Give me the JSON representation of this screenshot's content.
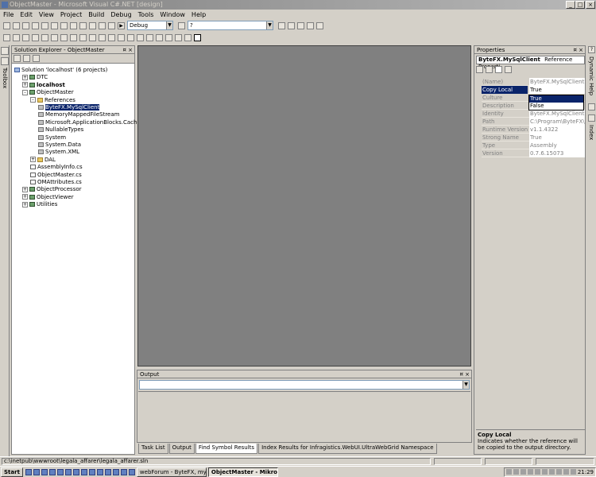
{
  "window": {
    "title": "ObjectMaster - Microsoft Visual C#.NET [design]"
  },
  "menu": [
    "File",
    "Edit",
    "View",
    "Project",
    "Build",
    "Debug",
    "Tools",
    "Window",
    "Help"
  ],
  "toolbar": {
    "config": "Debug",
    "find": "?"
  },
  "solution_explorer": {
    "title": "Solution Explorer - ObjectMaster",
    "tree": [
      {
        "label": "Solution 'localhost' (6 projects)",
        "indent": 0,
        "icon": "sol",
        "exp": ""
      },
      {
        "label": "DTC",
        "indent": 1,
        "icon": "proj",
        "exp": "+"
      },
      {
        "label": "localhost",
        "indent": 1,
        "icon": "proj",
        "exp": "+",
        "bold": true
      },
      {
        "label": "ObjectMaster",
        "indent": 1,
        "icon": "proj",
        "exp": "-"
      },
      {
        "label": "References",
        "indent": 2,
        "icon": "folder",
        "exp": "-"
      },
      {
        "label": "ByteFX.MySqlClient",
        "indent": 3,
        "icon": "ref",
        "exp": "",
        "selected": true
      },
      {
        "label": "MemoryMappedFileStream",
        "indent": 3,
        "icon": "ref",
        "exp": ""
      },
      {
        "label": "Microsoft.ApplicationBlocks.Cache",
        "indent": 3,
        "icon": "ref",
        "exp": ""
      },
      {
        "label": "NullableTypes",
        "indent": 3,
        "icon": "ref",
        "exp": ""
      },
      {
        "label": "System",
        "indent": 3,
        "icon": "ref",
        "exp": ""
      },
      {
        "label": "System.Data",
        "indent": 3,
        "icon": "ref",
        "exp": ""
      },
      {
        "label": "System.XML",
        "indent": 3,
        "icon": "ref",
        "exp": ""
      },
      {
        "label": "DAL",
        "indent": 2,
        "icon": "folder",
        "exp": "+"
      },
      {
        "label": "AssemblyInfo.cs",
        "indent": 2,
        "icon": "file",
        "exp": ""
      },
      {
        "label": "ObjectMaster.cs",
        "indent": 2,
        "icon": "file",
        "exp": ""
      },
      {
        "label": "OMAttributes.cs",
        "indent": 2,
        "icon": "file",
        "exp": ""
      },
      {
        "label": "ObjectProcessor",
        "indent": 1,
        "icon": "proj",
        "exp": "+"
      },
      {
        "label": "ObjectViewer",
        "indent": 1,
        "icon": "proj",
        "exp": "+"
      },
      {
        "label": "Utilities",
        "indent": 1,
        "icon": "proj",
        "exp": "+"
      }
    ]
  },
  "output": {
    "title": "Output"
  },
  "bottom_tabs": [
    "Task List",
    "Output",
    "Find Symbol Results",
    "Index Results for Infragistics.WebUI.UltraWebGrid Namespace"
  ],
  "properties": {
    "title": "Properties",
    "object": "ByteFX.MySqlClient",
    "object_type": "Reference Properti",
    "rows": [
      {
        "name": "(Name)",
        "value": "ByteFX.MySqlClient"
      },
      {
        "name": "Copy Local",
        "value": "True",
        "active": true
      },
      {
        "name": "Culture",
        "value": ""
      },
      {
        "name": "Description",
        "value": ""
      },
      {
        "name": "Identity",
        "value": "ByteFX.MySqlClient"
      },
      {
        "name": "Path",
        "value": "C:\\Program\\ByteFX\\Byte"
      },
      {
        "name": "Runtime Version",
        "value": "v1.1.4322"
      },
      {
        "name": "Strong Name",
        "value": "True"
      },
      {
        "name": "Type",
        "value": "Assembly"
      },
      {
        "name": "Version",
        "value": "0.7.6.15073"
      }
    ],
    "dropdown_options": [
      "True",
      "False"
    ],
    "desc_title": "Copy Local",
    "desc_text": "Indicates whether the reference will be copied to the output directory."
  },
  "side_tabs": {
    "left": "Toolbox",
    "right": "Dynamic Help",
    "right2": "Index"
  },
  "status": {
    "path": "c:\\inetpub\\wwwroot\\legala_affarer\\legala_affarer.sln"
  },
  "taskbar": {
    "start": "Start",
    "tasks": [
      "webForum - ByteFX, my...",
      "ObjectMaster - Mikro..."
    ],
    "clock": "21:29"
  }
}
